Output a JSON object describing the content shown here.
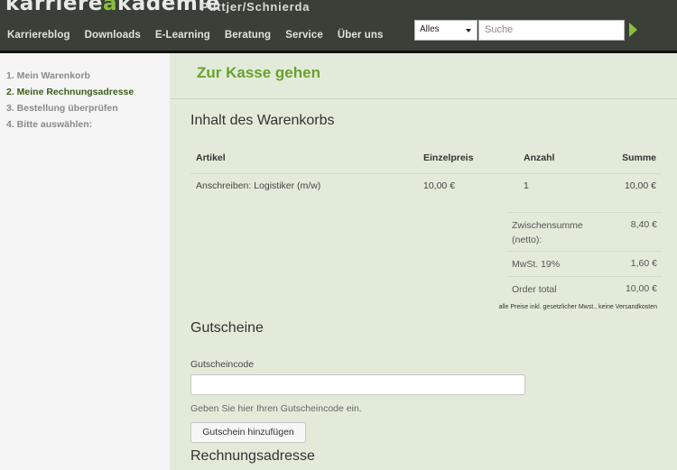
{
  "header": {
    "logo_part1": "karriere",
    "logo_part2": "a",
    "logo_part3": "kademie",
    "logo_sub": "Püttjer/Schnierda",
    "nav": [
      "Karriereblog",
      "Downloads",
      "E-Learning",
      "Beratung",
      "Service",
      "Über uns"
    ],
    "search_scope": "Alles",
    "search_placeholder": "Suche"
  },
  "sidebar": {
    "steps": [
      {
        "label": "1. Mein Warenkorb",
        "active": false
      },
      {
        "label": "2. Meine Rechnungsadresse",
        "active": true
      },
      {
        "label": "3. Bestellung überprüfen",
        "active": false
      },
      {
        "label": "4. Bitte auswählen:",
        "active": false
      }
    ]
  },
  "main": {
    "page_title": "Zur Kasse gehen",
    "cart_heading": "Inhalt des Warenkorbs",
    "table": {
      "headers": {
        "artikel": "Artikel",
        "einzelpreis": "Einzelpreis",
        "anzahl": "Anzahl",
        "summe": "Summe"
      },
      "rows": [
        {
          "artikel": "Anschreiben: Logistiker (m/w)",
          "einzelpreis": "10,00 €",
          "anzahl": "1",
          "summe": "10,00 €"
        }
      ]
    },
    "totals": {
      "subtotal_label": "Zwischensumme (netto):",
      "subtotal_value": "8,40 €",
      "vat_label": "MwSt. 19%",
      "vat_value": "1,60 €",
      "total_label": "Order total",
      "total_value": "10,00 €"
    },
    "vat_note": "alle Preise inkl. gesetzlicher Mwst., keine Versandkosten",
    "coupon_heading": "Gutscheine",
    "coupon_label": "Gutscheincode",
    "coupon_help": "Geben Sie hier Ihren Gutscheincode ein.",
    "coupon_button": "Gutschein hinzufügen",
    "billing_heading": "Rechnungsadresse"
  }
}
